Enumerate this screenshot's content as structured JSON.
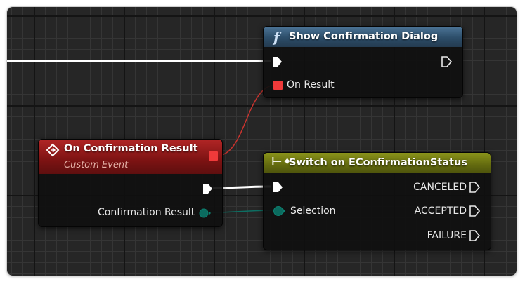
{
  "nodes": {
    "show_dialog": {
      "title": "Show Confirmation Dialog",
      "pins": {
        "on_result_label": "On Result"
      }
    },
    "custom_event": {
      "title": "On Confirmation Result",
      "subtitle": "Custom Event",
      "pins": {
        "param_label": "Confirmation Result"
      }
    },
    "switch": {
      "title": "Switch on EConfirmationStatus",
      "pins": {
        "selection_label": "Selection",
        "outputs": [
          "CANCELED",
          "ACCEPTED",
          "FAILURE"
        ]
      }
    }
  },
  "colors": {
    "exec_wire": "#ffffff",
    "delegate_pin": "#ef3a3a",
    "enum_pin": "#0b6b5f",
    "function_header": "#31536f",
    "event_header": "#8a1414",
    "switch_header": "#6f7611"
  },
  "icons": {
    "function_icon": "function-f-icon",
    "event_icon": "event-diamond-icon",
    "switch_icon": "switch-icon"
  }
}
